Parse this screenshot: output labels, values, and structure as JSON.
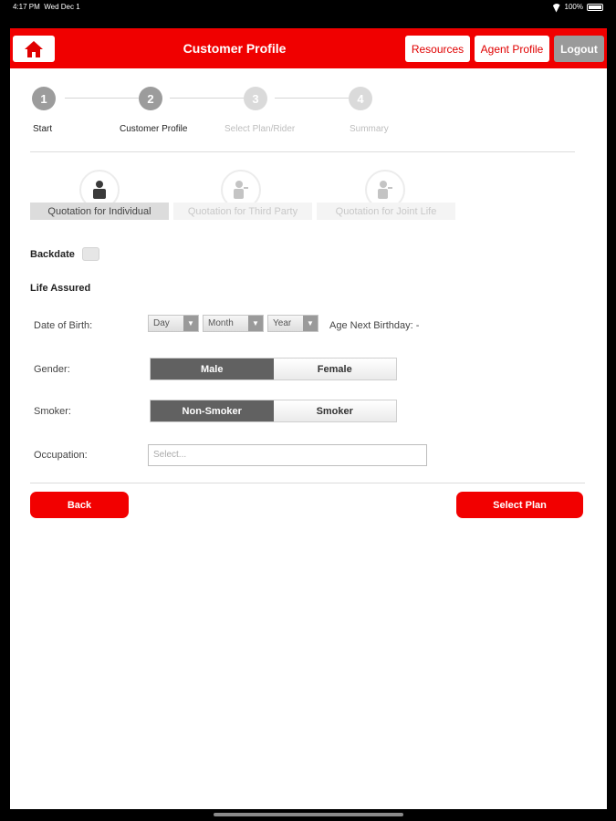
{
  "status_bar": {
    "time": "4:17 PM",
    "date": "Wed Dec 1",
    "battery": "100%"
  },
  "header": {
    "title": "Customer Profile",
    "home_icon": "home-icon",
    "buttons": {
      "resources": "Resources",
      "agent_profile": "Agent Profile",
      "logout": "Logout"
    },
    "accent_color": "#f00000"
  },
  "steps": [
    {
      "number": "1",
      "label": "Start",
      "state": "done"
    },
    {
      "number": "2",
      "label": "Customer Profile",
      "state": "current"
    },
    {
      "number": "3",
      "label": "Select Plan/Rider",
      "state": "upcoming"
    },
    {
      "number": "4",
      "label": "Summary",
      "state": "upcoming"
    }
  ],
  "quotation_tabs": [
    {
      "label": "Quotation for Individual",
      "icon": "person-icon",
      "selected": true
    },
    {
      "label": "Quotation for Third Party",
      "icon": "third-party-icon",
      "selected": false
    },
    {
      "label": "Quotation for Joint Life",
      "icon": "joint-life-icon",
      "selected": false
    }
  ],
  "form": {
    "backdate_label": "Backdate",
    "section_title": "Life Assured",
    "dob_label": "Date of Birth:",
    "dob": {
      "day": "Day",
      "month": "Month",
      "year": "Year"
    },
    "age_next_birthday": "Age Next Birthday: -",
    "gender_label": "Gender:",
    "gender_options": [
      "Male",
      "Female"
    ],
    "gender_selected": "Male",
    "smoker_label": "Smoker:",
    "smoker_options": [
      "Non-Smoker",
      "Smoker"
    ],
    "smoker_selected": "Non-Smoker",
    "occupation_label": "Occupation:",
    "occupation_placeholder": "Select..."
  },
  "actions": {
    "back": "Back",
    "select_plan": "Select Plan"
  }
}
